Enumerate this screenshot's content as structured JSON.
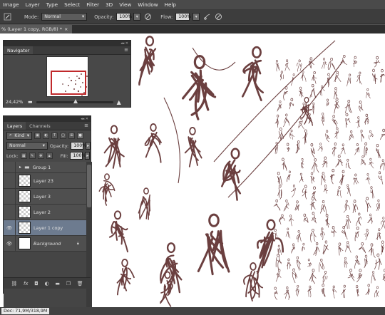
{
  "menubar": {
    "items": [
      "Image",
      "Layer",
      "Type",
      "Select",
      "Filter",
      "3D",
      "View",
      "Window",
      "Help"
    ]
  },
  "options": {
    "mode_label": "Mode:",
    "mode_value": "Normal",
    "opacity_label": "Opacity:",
    "opacity_value": "100%",
    "flow_label": "Flow:",
    "flow_value": "100%"
  },
  "document_tab": {
    "title": "% (Layer 1 copy, RGB/8) *",
    "close": "×"
  },
  "navigator": {
    "tab": "Navigator",
    "zoom": "24,42%"
  },
  "layers": {
    "tabs": [
      "Layers",
      "Channels"
    ],
    "filter_value": "Kind",
    "blend_mode": "Normal",
    "opacity_label": "Opacity:",
    "opacity_value": "100%",
    "lock_label": "Lock:",
    "fill_label": "Fill:",
    "fill_value": "100%",
    "items": [
      {
        "name": "Group 1",
        "visible": false,
        "selected": false
      },
      {
        "name": "Layer 23",
        "visible": false,
        "selected": false
      },
      {
        "name": "Layer 3",
        "visible": false,
        "selected": false
      },
      {
        "name": "Layer 2",
        "visible": false,
        "selected": false
      },
      {
        "name": "Layer 1 copy",
        "visible": true,
        "selected": true
      },
      {
        "name": "Background",
        "visible": true,
        "selected": false
      }
    ]
  },
  "status": {
    "doc": "Doc: 71,9M/318,9M"
  },
  "icons": {
    "collapse": "collapse-arrows-icon",
    "menu": "panel-menu-icon"
  },
  "colors": {
    "sketch_stroke": "#6b3f3f",
    "selection_red": "#c0292b",
    "selected_layer": "#6d7b8f"
  }
}
